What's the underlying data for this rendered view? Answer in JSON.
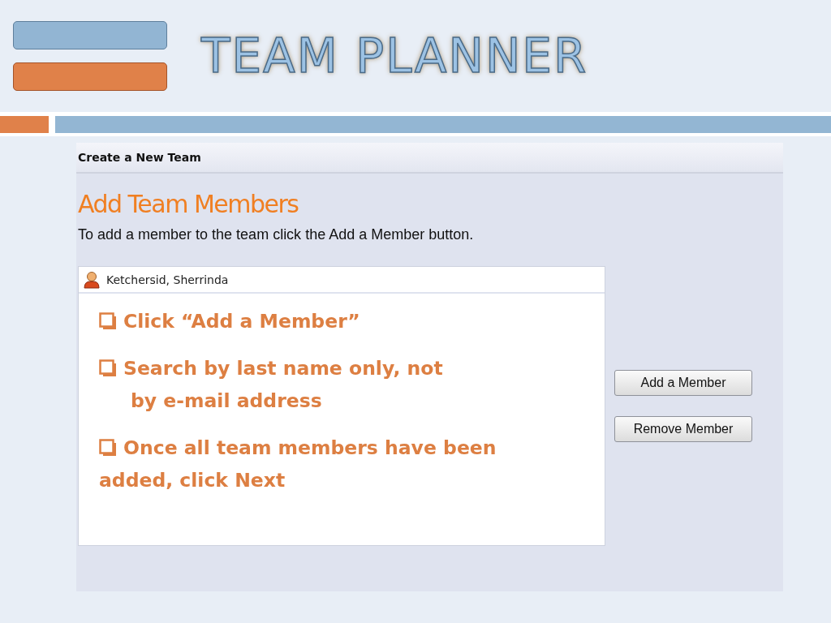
{
  "slide_title": "TEAM PLANNER",
  "app": {
    "header": "Create a New Team",
    "heading": "Add Team Members",
    "instruction": "To add a member to the team click the Add a Member button.",
    "members": [
      {
        "name": "Ketchersid, Sherrinda"
      }
    ],
    "notes": [
      {
        "kind": "indented",
        "lines": [
          "Click “Add a Member”"
        ]
      },
      {
        "kind": "indented",
        "lines": [
          "Search by last name only, not",
          "by  e-mail address"
        ]
      },
      {
        "kind": "flush",
        "lines": [
          "Once all team members have been",
          "added, click Next"
        ]
      }
    ],
    "buttons": [
      "Add a Member",
      "Remove Member"
    ]
  }
}
